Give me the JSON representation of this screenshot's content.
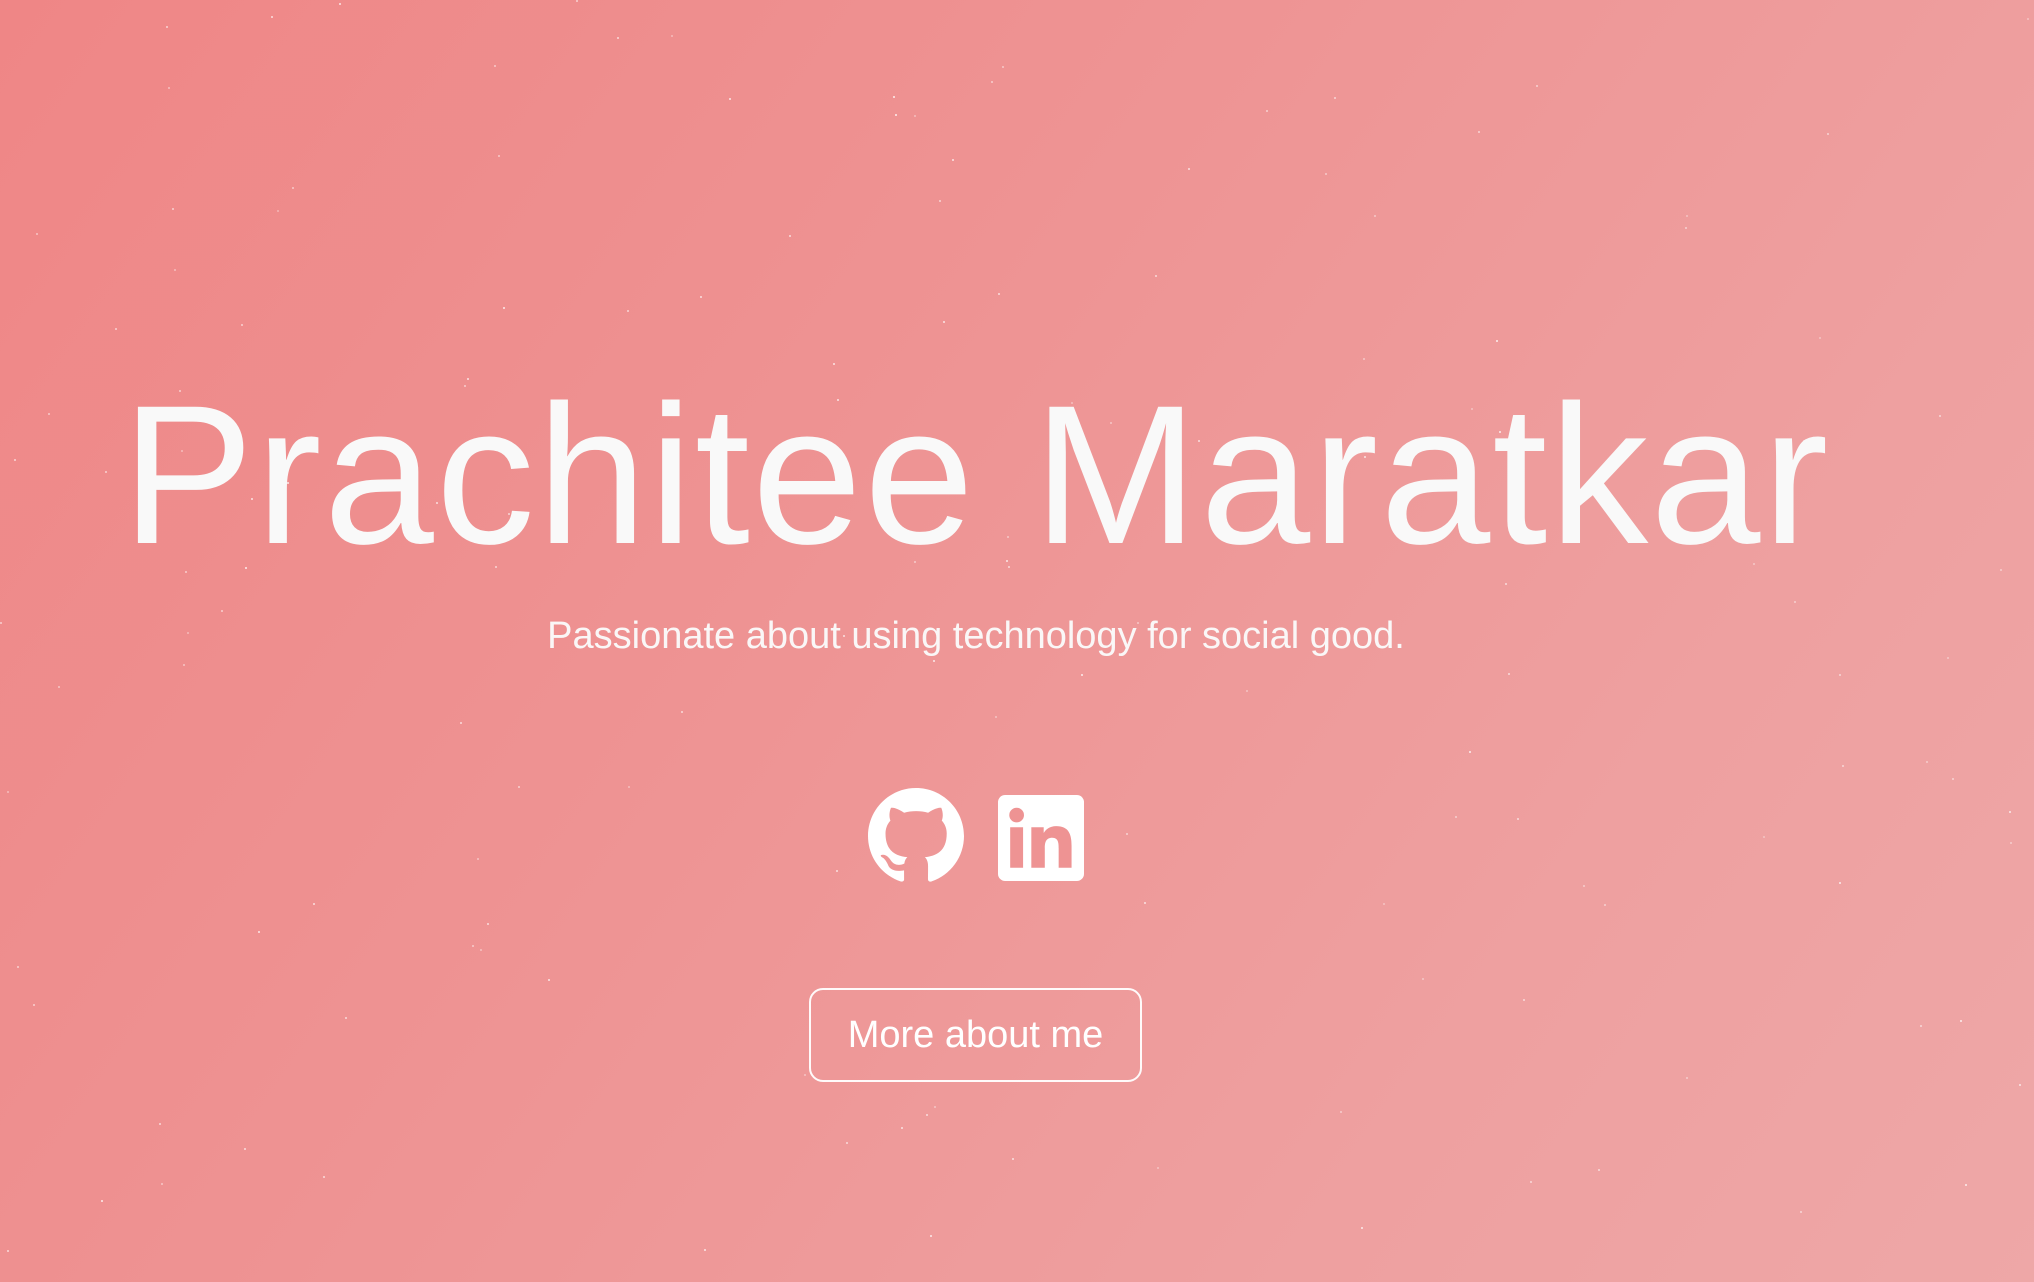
{
  "hero": {
    "name": "Prachitee Maratkar",
    "tagline": "Passionate about using technology for social good.",
    "background_colors": [
      "#ef8686",
      "#eea7a7"
    ]
  },
  "social": {
    "icons": [
      "github-icon",
      "linkedin-icon"
    ]
  },
  "cta": {
    "label": "More about me"
  }
}
